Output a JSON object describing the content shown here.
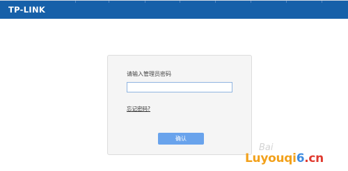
{
  "header": {
    "brand": "TP-LINK",
    "bar_color": "#1660a9"
  },
  "login": {
    "prompt": "请输入管理员密码",
    "password_value": "",
    "forgot_link": "忘记密码?",
    "confirm_label": "确认",
    "accent_color": "#69a3ec"
  },
  "watermark": {
    "baidu": "Bai",
    "part1": "Luyouqi",
    "six": "6",
    "tail": ".cn"
  }
}
